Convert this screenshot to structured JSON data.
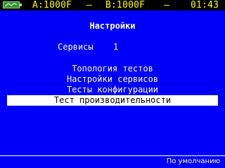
{
  "status_bar": {
    "battery_icon": "battery-icon",
    "port_a": "A:1000F",
    "separator_1": "–",
    "port_b": "B:1000F",
    "separator_2": "–",
    "time": "01:43",
    "text_color": "#ffff00"
  },
  "screen": {
    "title": "Настройки",
    "service": {
      "label": "Сервисы",
      "value": "1"
    }
  },
  "menu": {
    "items": [
      {
        "label": "Топология тестов",
        "selected": false
      },
      {
        "label": "Настройки сервисов",
        "selected": false
      },
      {
        "label": "Тесты конфигурации",
        "selected": false
      },
      {
        "label": "Тест производительности",
        "selected": true
      }
    ]
  },
  "footer": {
    "default_button": "По умолчанию"
  },
  "colors": {
    "background": "#0000f8",
    "status_bar": "#000000",
    "text": "#ffffff",
    "selection": "#ffffff"
  }
}
